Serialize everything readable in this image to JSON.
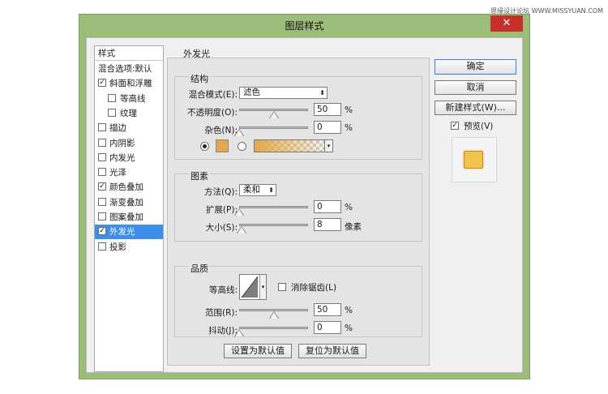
{
  "watermark": "思缘设计论坛 WWW.MISSYUAN.COM",
  "window": {
    "title": "图层样式",
    "close_glyph": "✕"
  },
  "sidebar": {
    "header": "样式",
    "items": [
      {
        "label": "混合选项:默认",
        "checkbox": false,
        "checked": false,
        "indent": false,
        "selected": false
      },
      {
        "label": "斜面和浮雕",
        "checkbox": true,
        "checked": true,
        "indent": false,
        "selected": false
      },
      {
        "label": "等高线",
        "checkbox": true,
        "checked": false,
        "indent": true,
        "selected": false
      },
      {
        "label": "纹理",
        "checkbox": true,
        "checked": false,
        "indent": true,
        "selected": false
      },
      {
        "label": "描边",
        "checkbox": true,
        "checked": false,
        "indent": false,
        "selected": false
      },
      {
        "label": "内阴影",
        "checkbox": true,
        "checked": false,
        "indent": false,
        "selected": false
      },
      {
        "label": "内发光",
        "checkbox": true,
        "checked": false,
        "indent": false,
        "selected": false
      },
      {
        "label": "光泽",
        "checkbox": true,
        "checked": false,
        "indent": false,
        "selected": false
      },
      {
        "label": "颜色叠加",
        "checkbox": true,
        "checked": true,
        "indent": false,
        "selected": false
      },
      {
        "label": "渐变叠加",
        "checkbox": true,
        "checked": false,
        "indent": false,
        "selected": false
      },
      {
        "label": "图案叠加",
        "checkbox": true,
        "checked": false,
        "indent": false,
        "selected": false
      },
      {
        "label": "外发光",
        "checkbox": true,
        "checked": true,
        "indent": false,
        "selected": true
      },
      {
        "label": "投影",
        "checkbox": true,
        "checked": false,
        "indent": false,
        "selected": false
      }
    ]
  },
  "panel": {
    "title": "外发光",
    "structure": {
      "title": "结构",
      "blend_mode_label": "混合模式(E):",
      "blend_mode_value": "滤色",
      "opacity_label": "不透明度(O):",
      "opacity_value": "50",
      "opacity_fraction": 0.5,
      "noise_label": "杂色(N):",
      "noise_value": "0",
      "noise_fraction": 0.0,
      "percent": "%",
      "glow_color": "#e2a84a"
    },
    "elements": {
      "title": "图素",
      "method_label": "方法(Q):",
      "method_value": "柔和",
      "spread_label": "扩展(P):",
      "spread_value": "0",
      "spread_fraction": 0.0,
      "size_label": "大小(S):",
      "size_value": "8",
      "size_fraction": 0.03,
      "percent": "%",
      "px_unit": "像素"
    },
    "quality": {
      "title": "品质",
      "contour_label": "等高线:",
      "antialias_label": "消除锯齿(L)",
      "range_label": "范围(R):",
      "range_value": "50",
      "range_fraction": 0.5,
      "jitter_label": "抖动(J):",
      "jitter_value": "0",
      "jitter_fraction": 0.0,
      "percent": "%"
    },
    "set_default_label": "设置为默认值",
    "reset_default_label": "复位为默认值"
  },
  "actions": {
    "ok_label": "确定",
    "cancel_label": "取消",
    "new_style_label": "新建样式(W)...",
    "preview_label": "预览(V)",
    "preview_checked": true,
    "preview_color": "#f2c14e"
  },
  "colors": {
    "window_frame": "#9cbc7a",
    "close_button": "#c7302a",
    "selection": "#3d8ee8"
  }
}
